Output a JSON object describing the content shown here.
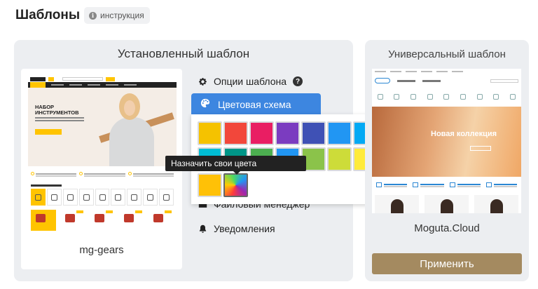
{
  "page": {
    "title": "Шаблоны",
    "help_label": "инструкция"
  },
  "installed": {
    "title": "Установленный шаблон",
    "template_name": "mg-gears",
    "preview": {
      "hero_line1": "НАБОР",
      "hero_line2": "ИНСТРУМЕНТОВ"
    },
    "options": {
      "template_options": "Опции шаблона",
      "color_scheme": "Цветовая схема",
      "file_manager": "Файловый менеджер",
      "notifications": "Уведомления"
    },
    "palette": {
      "tooltip": "Назначить свои цвета",
      "rows": [
        [
          "#f5c200",
          "#f2473b",
          "#e91e63",
          "#7b3cc0",
          "#3f51b5",
          "#2196f3",
          "#03a9f4"
        ],
        [
          "#00bcd4",
          "#009688",
          "#4caf50",
          "#2196f3",
          "#8bc34a",
          "#cddc39",
          "#ffeb3b"
        ],
        [
          "#ffc107",
          "custom"
        ]
      ]
    }
  },
  "universal": {
    "title": "Универсальный шаблон",
    "template_name": "Moguta.Cloud",
    "preview": {
      "hero_text": "Новая коллекция"
    },
    "apply_label": "Применить"
  },
  "colors": {
    "accent_blue": "#3d86e0",
    "apply_brown": "#a48a60",
    "card_bg": "#eceef1"
  }
}
